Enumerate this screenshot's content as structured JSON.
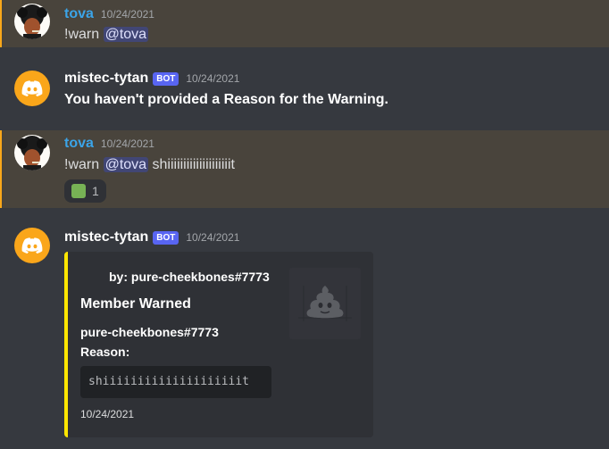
{
  "messages": [
    {
      "username": "tova",
      "timestamp": "10/24/2021",
      "text_prefix": "!warn ",
      "mention": "@tova",
      "text_suffix": ""
    },
    {
      "username": "mistec-tytan",
      "bot_tag": "BOT",
      "timestamp": "10/24/2021",
      "text": "You haven't provided a Reason for the Warning."
    },
    {
      "username": "tova",
      "timestamp": "10/24/2021",
      "text_prefix": "!warn ",
      "mention": "@tova",
      "text_suffix": " shiiiiiiiiiiiiiiiiiiiit",
      "reaction": {
        "emoji": "green-square",
        "count": "1"
      }
    },
    {
      "username": "mistec-tytan",
      "bot_tag": "BOT",
      "timestamp": "10/24/2021",
      "embed": {
        "author": "by: pure-cheekbones#7773",
        "title": "Member Warned",
        "field_name": "pure-cheekbones#7773",
        "field_label": "Reason:",
        "reason_code": "shiiiiiiiiiiiiiiiiiiiit",
        "footer": "10/24/2021",
        "thumbnail_icon": "poop-icon",
        "accent_color": "#ffe600"
      }
    }
  ],
  "colors": {
    "background": "#36393f",
    "mention_highlight": "#49443c",
    "mention_bar": "#faa81a",
    "user_name": "#3ba4e8",
    "bot_avatar": "#faa61a",
    "bot_tag": "#5865f2"
  }
}
